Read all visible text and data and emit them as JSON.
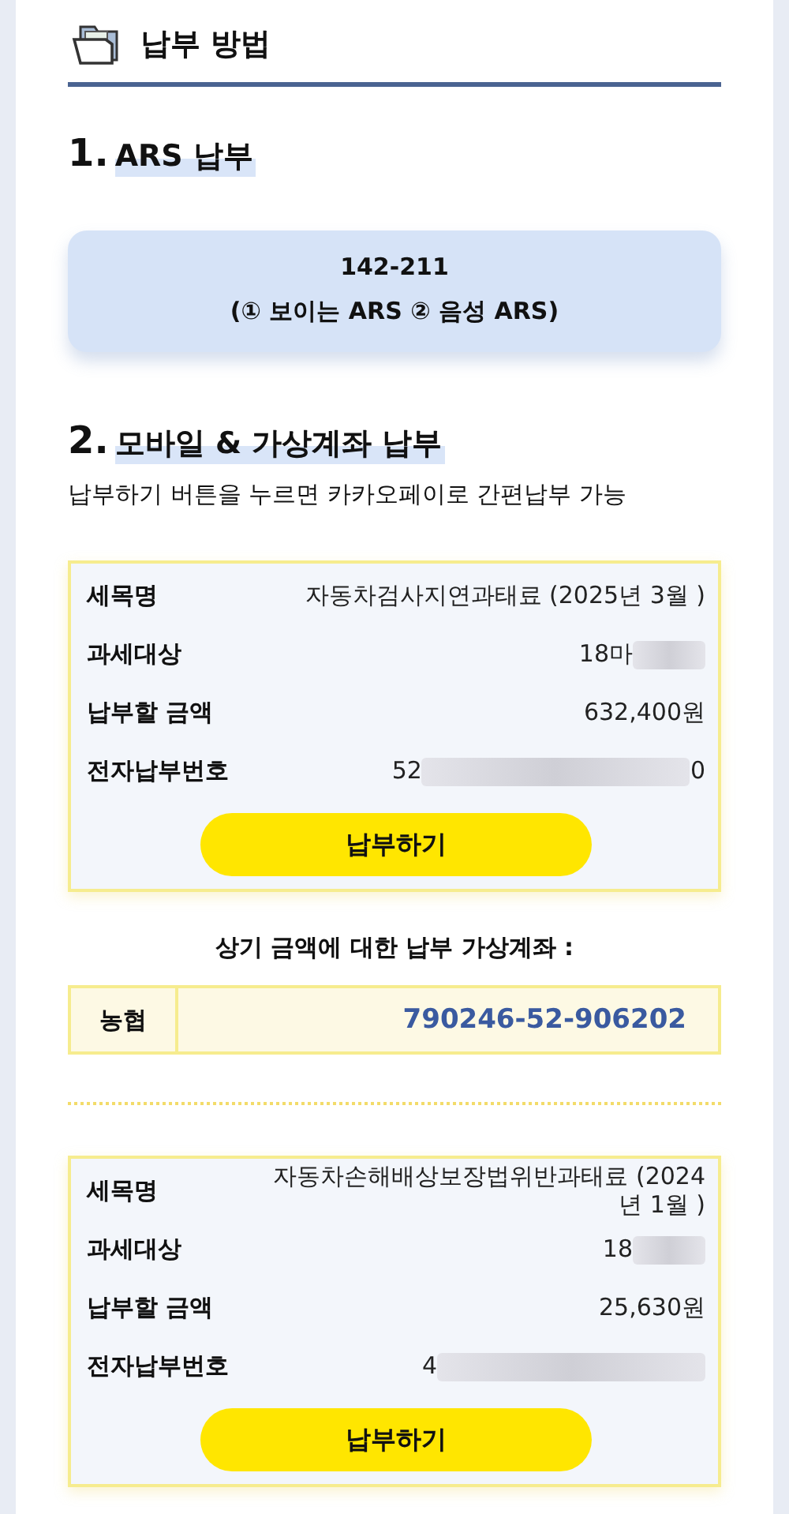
{
  "header": {
    "title": "납부 방법"
  },
  "ars": {
    "number": "1.",
    "title": "ARS 납부",
    "phone": "142-211",
    "options": "(① 보이는 ARS ② 음성 ARS)"
  },
  "mobile": {
    "number": "2.",
    "title": "모바일 & 가상계좌 납부",
    "description": "납부하기 버튼을 누르면 카카오페이로 간편납부 가능"
  },
  "bills": [
    {
      "rows": [
        {
          "label": "세목명",
          "parts": [
            {
              "kind": "text",
              "text": "자동차검사지연과태료 (2025년 3월 )"
            }
          ]
        },
        {
          "label": "과세대상",
          "parts": [
            {
              "kind": "text",
              "text": "18마"
            },
            {
              "kind": "blur"
            }
          ]
        },
        {
          "label": "납부할 금액",
          "parts": [
            {
              "kind": "text",
              "text": "632,400원"
            }
          ]
        },
        {
          "label": "전자납부번호",
          "parts": [
            {
              "kind": "text",
              "text": "52"
            },
            {
              "kind": "blur"
            },
            {
              "kind": "text",
              "text": "0"
            }
          ]
        }
      ],
      "button": "납부하기",
      "account": {
        "caption": "상기 금액에 대한 납부 가상계좌 :",
        "bank": "농협",
        "number": "790246-52-906202"
      }
    },
    {
      "rows": [
        {
          "label": "세목명",
          "parts": [
            {
              "kind": "text",
              "text": "자동차손해배상보장법위반과태료 (2024년 1월 )"
            }
          ]
        },
        {
          "label": "과세대상",
          "parts": [
            {
              "kind": "text",
              "text": "18"
            },
            {
              "kind": "blur"
            }
          ]
        },
        {
          "label": "납부할 금액",
          "parts": [
            {
              "kind": "text",
              "text": "25,630원"
            }
          ]
        },
        {
          "label": "전자납부번호",
          "parts": [
            {
              "kind": "text",
              "text": "4"
            },
            {
              "kind": "blur"
            }
          ]
        }
      ],
      "button": "납부하기"
    }
  ]
}
